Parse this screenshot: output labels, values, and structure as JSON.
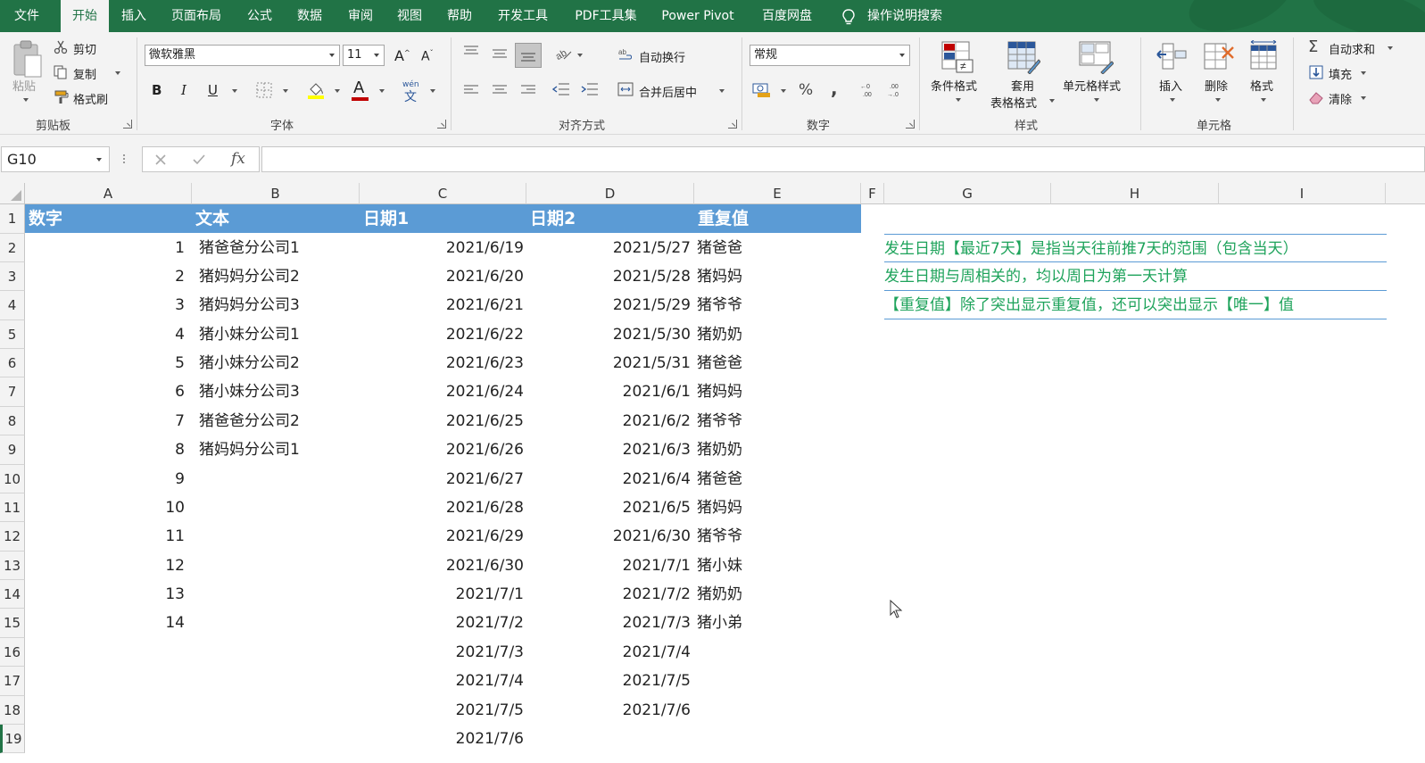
{
  "menu": {
    "file": "文件",
    "tabs": [
      "开始",
      "插入",
      "页面布局",
      "公式",
      "数据",
      "审阅",
      "视图",
      "帮助",
      "开发工具",
      "PDF工具集",
      "Power Pivot",
      "百度网盘"
    ],
    "active_tab": "开始",
    "tell_me": "操作说明搜索"
  },
  "ribbon": {
    "clipboard": {
      "label": "剪贴板",
      "paste": "粘贴",
      "cut": "剪切",
      "copy": "复制",
      "format_painter": "格式刷"
    },
    "font": {
      "label": "字体",
      "name": "微软雅黑",
      "size": "11",
      "bold": "B",
      "italic": "I",
      "underline": "U",
      "font_color_letter": "A",
      "wen": "wén"
    },
    "alignment": {
      "label": "对齐方式",
      "wrap_text": "自动换行",
      "merge_center": "合并后居中"
    },
    "number": {
      "label": "数字",
      "format": "常规",
      "percent": "%",
      "comma": ","
    },
    "styles": {
      "label": "样式",
      "conditional": "条件格式",
      "table_line1": "套用",
      "table_line2": "表格格式",
      "cell_styles": "单元格样式"
    },
    "cells": {
      "label": "单元格",
      "insert": "插入",
      "delete": "删除",
      "format": "格式"
    },
    "editing": {
      "autosum": "自动求和",
      "fill": "填充",
      "clear": "清除"
    }
  },
  "formula_bar": {
    "name_box": "G10",
    "fx": "fx",
    "value": ""
  },
  "sheet": {
    "columns": [
      "A",
      "B",
      "C",
      "D",
      "E",
      "F",
      "G",
      "H",
      "I"
    ],
    "row_numbers": [
      "1",
      "2",
      "3",
      "4",
      "5",
      "6",
      "7",
      "8",
      "9",
      "10",
      "11",
      "12",
      "13",
      "14",
      "15",
      "16",
      "17",
      "18",
      "19"
    ],
    "header": [
      "数字",
      "文本",
      "日期1",
      "日期2",
      "重复值"
    ],
    "col_a": [
      "1",
      "2",
      "3",
      "4",
      "5",
      "6",
      "7",
      "8",
      "9",
      "10",
      "11",
      "12",
      "13",
      "14"
    ],
    "col_b": [
      "猪爸爸分公司1",
      "猪妈妈分公司2",
      "猪妈妈分公司3",
      "猪小妹分公司1",
      "猪小妹分公司2",
      "猪小妹分公司3",
      "猪爸爸分公司2",
      "猪妈妈分公司1"
    ],
    "col_c": [
      "2021/6/19",
      "2021/6/20",
      "2021/6/21",
      "2021/6/22",
      "2021/6/23",
      "2021/6/24",
      "2021/6/25",
      "2021/6/26",
      "2021/6/27",
      "2021/6/28",
      "2021/6/29",
      "2021/6/30",
      "2021/7/1",
      "2021/7/2",
      "2021/7/3",
      "2021/7/4",
      "2021/7/5",
      "2021/7/6"
    ],
    "col_d": [
      "2021/5/27",
      "2021/5/28",
      "2021/5/29",
      "2021/5/30",
      "2021/5/31",
      "2021/6/1",
      "2021/6/2",
      "2021/6/3",
      "2021/6/4",
      "2021/6/5",
      "2021/6/30",
      "2021/7/1",
      "2021/7/2",
      "2021/7/3",
      "2021/7/4",
      "2021/7/5",
      "2021/7/6"
    ],
    "col_e": [
      "猪爸爸",
      "猪妈妈",
      "猪爷爷",
      "猪奶奶",
      "猪爸爸",
      "猪妈妈",
      "猪爷爷",
      "猪奶奶",
      "猪爸爸",
      "猪妈妈",
      "猪爷爷",
      "猪小妹",
      "猪奶奶",
      "猪小弟"
    ],
    "notes": [
      "发生日期【最近7天】是指当天往前推7天的范围（包含当天）",
      "发生日期与周相关的，均以周日为第一天计算",
      "【重复值】除了突出显示重复值，还可以突出显示【唯一】值"
    ]
  },
  "colors": {
    "excel_green": "#217346",
    "header_fill": "#5b9bd5",
    "note_text": "#1ea35b"
  }
}
